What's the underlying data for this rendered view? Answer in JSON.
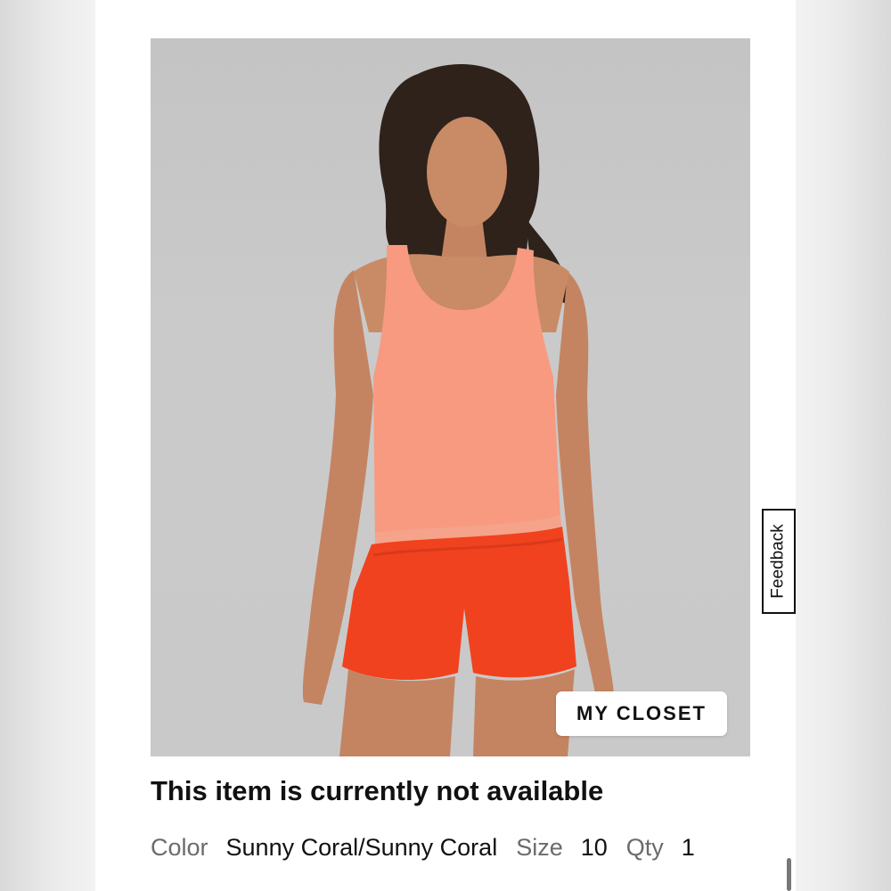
{
  "product": {
    "image_alt": "Model wearing Sunny Coral tank top and red-orange shorts",
    "closet_button_label": "MY CLOSET",
    "status": "This item is currently not available"
  },
  "details": {
    "color_label": "Color",
    "color_value": "Sunny Coral/Sunny Coral",
    "size_label": "Size",
    "size_value": "10",
    "qty_label": "Qty",
    "qty_value": "1"
  },
  "feedback": {
    "label": "Feedback"
  },
  "colors": {
    "tank": "#f79a80",
    "shorts": "#f0421e",
    "skin": "#c98a66",
    "hair": "#2e221b",
    "backdrop": "#c6c6c6"
  }
}
